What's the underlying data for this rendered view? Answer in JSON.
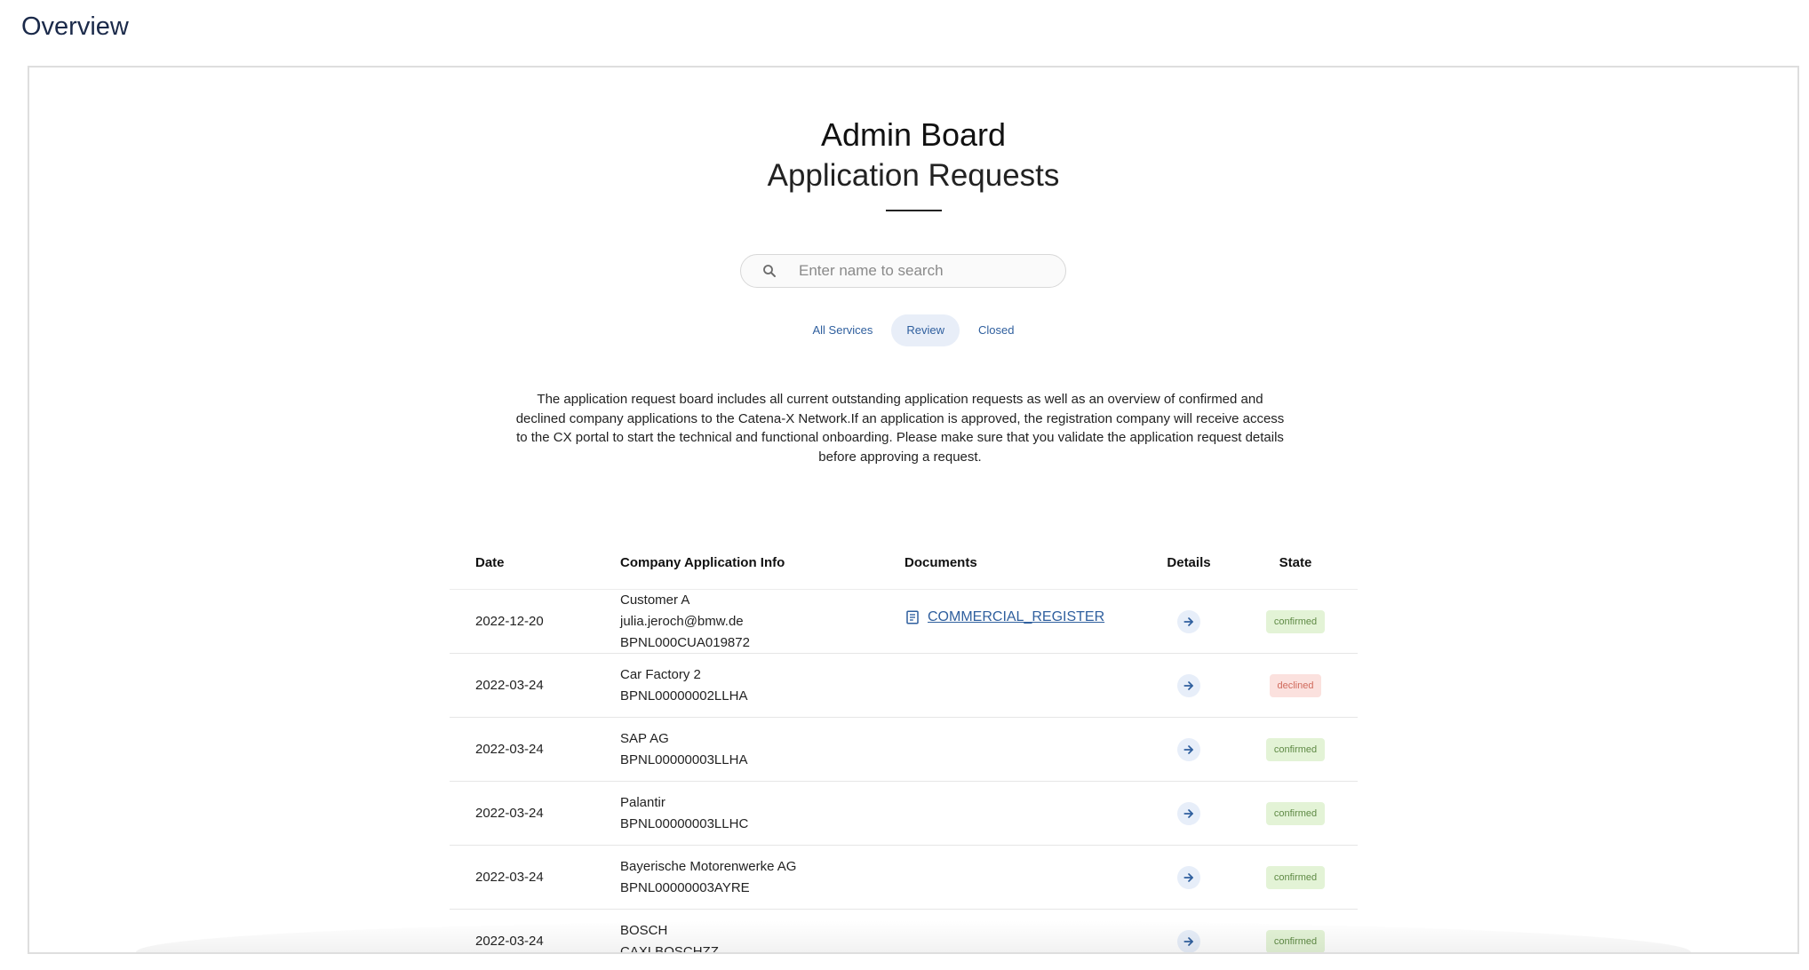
{
  "page": {
    "heading": "Overview"
  },
  "header": {
    "title": "Admin Board",
    "subtitle": "Application Requests"
  },
  "search": {
    "placeholder": "Enter name to search",
    "value": ""
  },
  "tabs": [
    {
      "label": "All Services",
      "active": false
    },
    {
      "label": "Review",
      "active": true
    },
    {
      "label": "Closed",
      "active": false
    }
  ],
  "description": "The application request board includes all current outstanding application requests as well as an overview of confirmed and declined company applications to the Catena-X Network.If an application is approved, the registration company will receive access to the CX portal to start the technical and functional onboarding. Please make sure that you validate the application request details before approving a request.",
  "table": {
    "columns": [
      "Date",
      "Company Application Info",
      "Documents",
      "Details",
      "State"
    ],
    "rows": [
      {
        "date": "2022-12-20",
        "company": "Customer A",
        "email": "julia.jeroch@bmw.de",
        "bpn": "BPNL000CUA019872",
        "document": "COMMERCIAL_REGISTER",
        "state": "confirmed"
      },
      {
        "date": "2022-03-24",
        "company": "Car Factory 2",
        "email": "",
        "bpn": "BPNL00000002LLHA",
        "document": "",
        "state": "declined"
      },
      {
        "date": "2022-03-24",
        "company": "SAP AG",
        "email": "",
        "bpn": "BPNL00000003LLHA",
        "document": "",
        "state": "confirmed"
      },
      {
        "date": "2022-03-24",
        "company": "Palantir",
        "email": "",
        "bpn": "BPNL00000003LLHC",
        "document": "",
        "state": "confirmed"
      },
      {
        "date": "2022-03-24",
        "company": "Bayerische Motorenwerke AG",
        "email": "",
        "bpn": "BPNL00000003AYRE",
        "document": "",
        "state": "confirmed"
      },
      {
        "date": "2022-03-24",
        "company": "BOSCH",
        "email": "",
        "bpn": "CAXLBOSCHZZ",
        "document": "",
        "state": "confirmed"
      }
    ]
  },
  "icons": {
    "search": "search-icon",
    "document": "document-icon",
    "details": "arrow-right-icon"
  },
  "colors": {
    "accent": "#2f5f9e",
    "confirmed_bg": "#e3f3d6",
    "declined_bg": "#fbe1de"
  }
}
